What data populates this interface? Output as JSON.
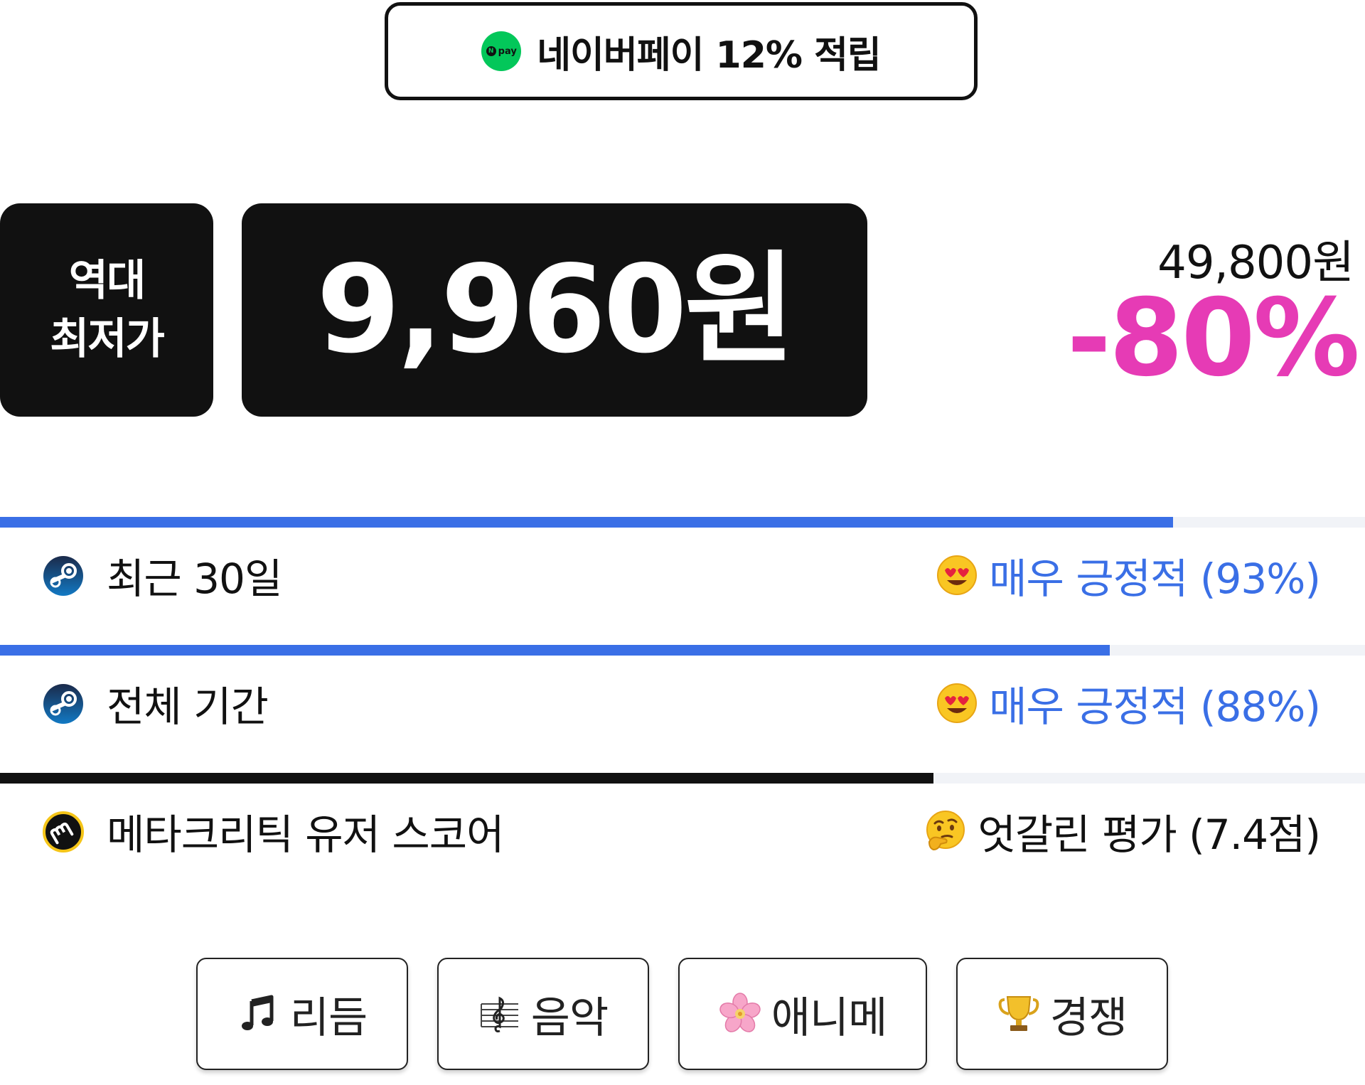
{
  "npay": {
    "logo_letter": "N",
    "logo_text": "pay",
    "text": "네이버페이 12% 적립"
  },
  "price": {
    "badge_line1": "역대",
    "badge_line2": "최저가",
    "current": "9,960원",
    "original": "49,800원",
    "discount": "-80%"
  },
  "reviews": [
    {
      "source_icon": "steam-icon",
      "label": "최근 30일",
      "emoji": "heart-eyes-emoji",
      "verdict": "매우 긍정적 (93%)",
      "score_fraction": 0.93,
      "bar_color": "#3a6fe6",
      "text_color": "#3a6fe6"
    },
    {
      "source_icon": "steam-icon",
      "label": "전체 기간",
      "emoji": "heart-eyes-emoji",
      "verdict": "매우 긍정적 (88%)",
      "score_fraction": 0.88,
      "bar_color": "#3a6fe6",
      "text_color": "#3a6fe6"
    },
    {
      "source_icon": "metacritic-icon",
      "label": "메타크리틱 유저 스코어",
      "emoji": "thinking-emoji",
      "verdict": "엇갈린 평가 (7.4점)",
      "score_fraction": 0.74,
      "bar_color": "#111111",
      "text_color": "#111111"
    }
  ],
  "tags": [
    {
      "icon": "music-note-icon",
      "label": "리듬"
    },
    {
      "icon": "musical-score-icon",
      "label": "음악"
    },
    {
      "icon": "cherry-blossom-icon",
      "label": "애니메"
    },
    {
      "icon": "trophy-icon",
      "label": "경쟁"
    }
  ],
  "colors": {
    "npay_green": "#03c75a",
    "discount_pink": "#e63bb5",
    "positive_blue": "#3a6fe6",
    "dark": "#111111",
    "track": "#f1f3f7"
  }
}
